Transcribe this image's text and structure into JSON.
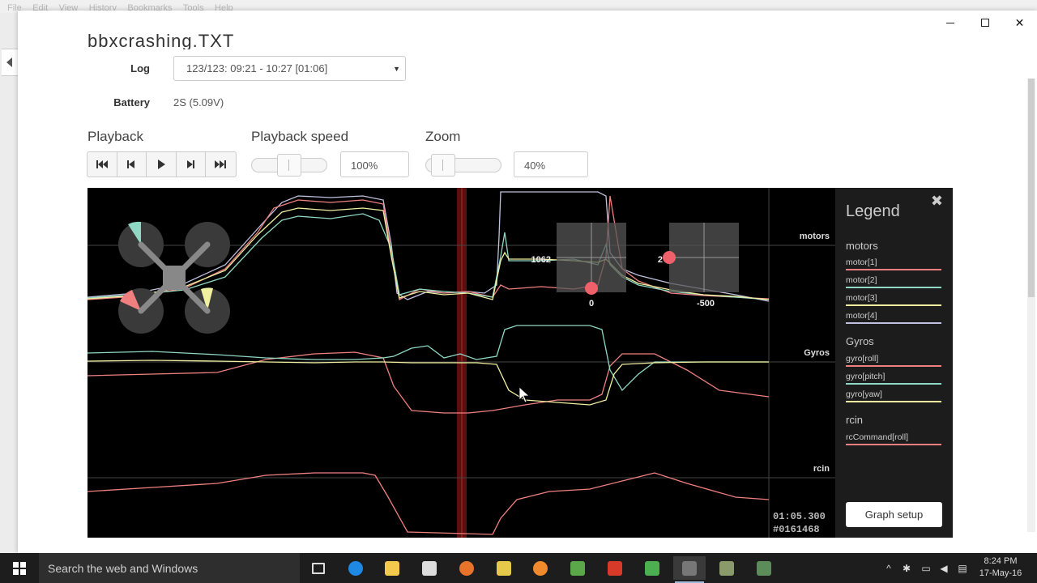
{
  "browser": {
    "menu": [
      "File",
      "Edit",
      "View",
      "History",
      "Bookmarks",
      "Tools",
      "Help"
    ]
  },
  "header": {
    "file_title": "bbxcrashing.TXT",
    "log_label": "Log",
    "log_selected": "123/123: 09:21 - 10:27 [01:06]",
    "battery_label": "Battery",
    "battery_value": "2S (5.09V)"
  },
  "controls": {
    "playback_label": "Playback",
    "speed_label": "Playback speed",
    "zoom_label": "Zoom",
    "speed_value": "100%",
    "zoom_value": "40%",
    "speed_level": 0.5,
    "zoom_level": 0.1
  },
  "graph": {
    "groups": [
      "motors",
      "Gyros",
      "rcin"
    ],
    "stick_labels": [
      "1062",
      "0",
      "2",
      "-500"
    ],
    "time": "01:05.300",
    "frame": "#0161468",
    "colors": {
      "motor1": "#f08080",
      "motor2": "#8fd8c4",
      "motor3": "#f0f0a0",
      "motor4": "#c0c0e0",
      "cursor": "#8b1a1a"
    }
  },
  "legend": {
    "title": "Legend",
    "groups": [
      {
        "name": "motors",
        "items": [
          {
            "label": "motor[1]",
            "color": "#f08080"
          },
          {
            "label": "motor[2]",
            "color": "#8fd8c4"
          },
          {
            "label": "motor[3]",
            "color": "#f0f0a0"
          },
          {
            "label": "motor[4]",
            "color": "#c0c0e0"
          }
        ]
      },
      {
        "name": "Gyros",
        "items": [
          {
            "label": "gyro[roll]",
            "color": "#f08080"
          },
          {
            "label": "gyro[pitch]",
            "color": "#8fd8c4"
          },
          {
            "label": "gyro[yaw]",
            "color": "#f0f0a0"
          }
        ]
      },
      {
        "name": "rcin",
        "items": [
          {
            "label": "rcCommand[roll]",
            "color": "#f08080"
          }
        ]
      }
    ],
    "setup_button": "Graph setup"
  },
  "taskbar": {
    "search_placeholder": "Search the web and Windows",
    "time": "8:24 PM",
    "date": "17-May-16"
  }
}
